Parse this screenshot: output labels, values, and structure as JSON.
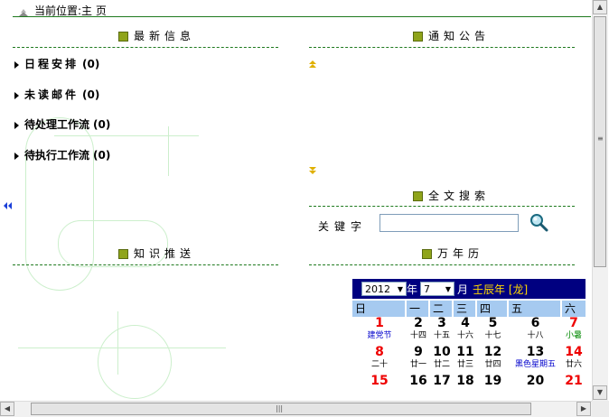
{
  "breadcrumb": {
    "label": "当前位置:主 页"
  },
  "panels": {
    "latest": {
      "title": "最新信息"
    },
    "notice": {
      "title": "通知公告"
    },
    "search": {
      "title": "全文搜索",
      "keyword_label": "关键字",
      "input_value": ""
    },
    "knowledge": {
      "title": "知识推送"
    },
    "calendar": {
      "title": "万年历"
    }
  },
  "latest_items": [
    {
      "label": "日程安排",
      "count": "(0)"
    },
    {
      "label": "未读邮件",
      "count": "(0)"
    },
    {
      "label": "待处理工作流",
      "count": "(0)"
    },
    {
      "label": "待执行工作流",
      "count": "(0)"
    }
  ],
  "calendar": {
    "year": "2012",
    "year_suffix": "年",
    "month": "7",
    "month_suffix": "月",
    "ganzhi": "壬辰年 [龙]",
    "weekdays": [
      "日",
      "一",
      "二",
      "三",
      "四",
      "五",
      "六"
    ],
    "rows": [
      [
        {
          "d": "1",
          "l": "建党节",
          "red": true
        },
        {
          "d": "2",
          "l": "十四"
        },
        {
          "d": "3",
          "l": "十五"
        },
        {
          "d": "4",
          "l": "十六"
        },
        {
          "d": "5",
          "l": "十七"
        },
        {
          "d": "6",
          "l": "十八"
        },
        {
          "d": "7",
          "l": "小暑",
          "red": true
        }
      ],
      [
        {
          "d": "8",
          "l": "二十",
          "red": true
        },
        {
          "d": "9",
          "l": "廿一"
        },
        {
          "d": "10",
          "l": "廿二"
        },
        {
          "d": "11",
          "l": "廿三"
        },
        {
          "d": "12",
          "l": "廿四"
        },
        {
          "d": "13",
          "l": "黑色星期五"
        },
        {
          "d": "14",
          "l": "廿六",
          "red": true
        }
      ],
      [
        {
          "d": "15",
          "l": "",
          "red": true
        },
        {
          "d": "16",
          "l": ""
        },
        {
          "d": "17",
          "l": ""
        },
        {
          "d": "18",
          "l": ""
        },
        {
          "d": "19",
          "l": ""
        },
        {
          "d": "20",
          "l": ""
        },
        {
          "d": "21",
          "l": "",
          "red": true
        }
      ]
    ],
    "label_colors": {
      "holiday": "#0000cc",
      "solar_term": "#008800",
      "special": "#0000cc",
      "normal": "#000000"
    }
  },
  "colors": {
    "rule": "#1e7a1e",
    "calendar_header": "#000080",
    "weekday_bg": "#a6caf0",
    "weekend": "#ee0000",
    "ganzhi": "#ffd700"
  }
}
